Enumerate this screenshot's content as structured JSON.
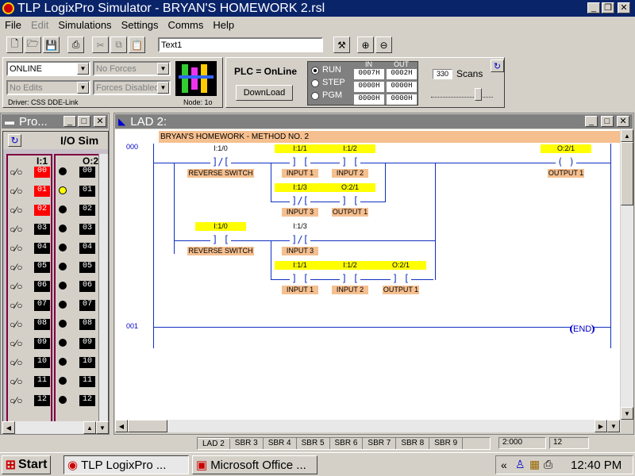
{
  "title": "TLP LogixPro Simulator  -  BRYAN'S HOMEWORK 2.rsl",
  "menu": [
    "File",
    "Edit",
    "Simulations",
    "Settings",
    "Comms",
    "Help"
  ],
  "toolbar": {
    "text_field": "Text1"
  },
  "status": {
    "mode": "ONLINE",
    "forces": "No Forces",
    "edits": "No Edits",
    "forces_state": "Forces Disabled",
    "driver": "Driver: CSS DDE-Link",
    "node": "Node: 1o",
    "plc_state": "PLC = OnLine",
    "download": "DownLoad",
    "run": "RUN",
    "step": "STEP",
    "pgm": "PGM",
    "in_label": "IN",
    "out_label": "OUT",
    "in_vals": [
      "0007H",
      "0000H",
      "0000H"
    ],
    "out_vals": [
      "0002H",
      "0000H",
      "0000H"
    ],
    "scans_value": "330",
    "scans_label": "Scans"
  },
  "pro_window": {
    "title": "Pro..."
  },
  "io_window": {
    "title": "I/O Sim",
    "input_header": "I:1",
    "output_header": "O:2",
    "rows": [
      "00",
      "01",
      "02",
      "03",
      "04",
      "05",
      "06",
      "07",
      "08",
      "09",
      "10",
      "11",
      "12"
    ],
    "inputs_on": [
      true,
      true,
      true,
      false,
      false,
      false,
      false,
      false,
      false,
      false,
      false,
      false,
      false
    ],
    "outputs_on": [
      false,
      true,
      false,
      false,
      false,
      false,
      false,
      false,
      false,
      false,
      false,
      false,
      false
    ]
  },
  "ladder": {
    "window_title": "LAD 2:",
    "comment": "BRYAN'S HOMEWORK - METHOD NO. 2",
    "rung0": "000",
    "rung1": "001",
    "end": "END",
    "elements": [
      {
        "addr": "I:1/0",
        "desc": "REVERSE SWITCH"
      },
      {
        "addr": "I:1/1",
        "desc": "INPUT 1"
      },
      {
        "addr": "I:1/2",
        "desc": "INPUT 2"
      },
      {
        "addr": "O:2/1",
        "desc": "OUTPUT 1"
      },
      {
        "addr": "I:1/3",
        "desc": "INPUT 3"
      },
      {
        "addr": "O:2/1",
        "desc": "OUTPUT 1"
      },
      {
        "addr": "I:1/0",
        "desc": "REVERSE SWITCH"
      },
      {
        "addr": "I:1/3",
        "desc": "INPUT 3"
      },
      {
        "addr": "I:1/1",
        "desc": "INPUT 1"
      },
      {
        "addr": "I:1/2",
        "desc": "INPUT 2"
      },
      {
        "addr": "O:2/1",
        "desc": "OUTPUT 1"
      }
    ]
  },
  "tabs": [
    "LAD 2",
    "SBR 3",
    "SBR 4",
    "SBR 5",
    "SBR 6",
    "SBR 7",
    "SBR 8",
    "SBR 9"
  ],
  "statusbar": {
    "coord": "2:000",
    "num": "12"
  },
  "taskbar": {
    "start": "Start",
    "task1": "TLP LogixPro ...",
    "task2": "Microsoft Office ...",
    "clock": "12:40 PM",
    "chevron": "«"
  },
  "colors": {
    "active_title": "#0a246a",
    "inactive_title": "#808080",
    "wire": "#1030c0",
    "address_bg": "#ffff00",
    "desc_bg": "#f5bf8f",
    "comment_bg": "#f5bf8f",
    "io_on": "#ff0000",
    "lamp_on": "#ffff00"
  }
}
